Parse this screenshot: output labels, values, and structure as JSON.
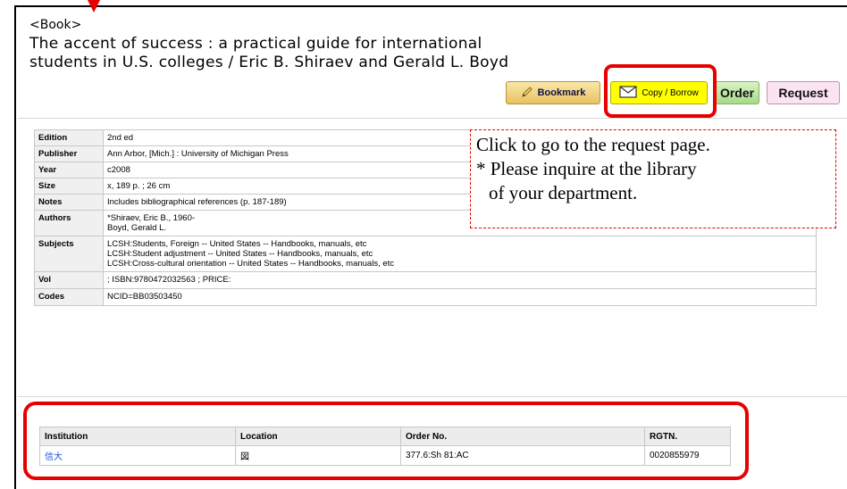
{
  "record": {
    "type_label": "<Book>",
    "title_line1": "The accent of success : a practical guide for international",
    "title_line2": "students in U.S. colleges / Eric B. Shiraev and Gerald L. Boyd"
  },
  "buttons": {
    "bookmark": "Bookmark",
    "copy_borrow": "Copy / Borrow",
    "order": "Order",
    "request": "Request"
  },
  "details": [
    {
      "key": "Edition",
      "value": [
        "2nd ed"
      ]
    },
    {
      "key": "Publisher",
      "value": [
        "Ann Arbor, [Mich.] : University of Michigan Press"
      ]
    },
    {
      "key": "Year",
      "value": [
        "c2008"
      ]
    },
    {
      "key": "Size",
      "value": [
        "x, 189 p. ; 26 cm"
      ]
    },
    {
      "key": "Notes",
      "value": [
        "Includes bibliographical references (p. 187-189)"
      ]
    },
    {
      "key": "Authors",
      "value": [
        "*Shiraev, Eric B., 1960-",
        "Boyd, Gerald L."
      ]
    },
    {
      "key": "Subjects",
      "value": [
        "LCSH:Students, Foreign -- United States -- Handbooks, manuals, etc",
        "LCSH:Student adjustment -- United States -- Handbooks, manuals, etc",
        "LCSH:Cross-cultural orientation -- United States -- Handbooks, manuals, etc"
      ]
    },
    {
      "key": "Vol",
      "value": [
        "; ISBN:9780472032563 ; PRICE:"
      ]
    },
    {
      "key": "Codes",
      "value": [
        "NCID=BB03503450"
      ]
    }
  ],
  "callout": {
    "line1": "Click to go to the request page.",
    "line2": "* Please inquire at the library",
    "line3": "of your department."
  },
  "holdings": {
    "headers": [
      "Institution",
      "Location",
      "Order No.",
      "RGTN."
    ],
    "rows": [
      {
        "institution": "信大",
        "location": "図",
        "order_no": "377.6:Sh 81:AC",
        "rgtn": "0020855979"
      }
    ]
  },
  "icons": {
    "bookmark": "pencil-icon",
    "copy_borrow": "envelope-icon"
  },
  "colors": {
    "annotation_red": "#e60000",
    "link_blue": "#1a4fd6"
  }
}
